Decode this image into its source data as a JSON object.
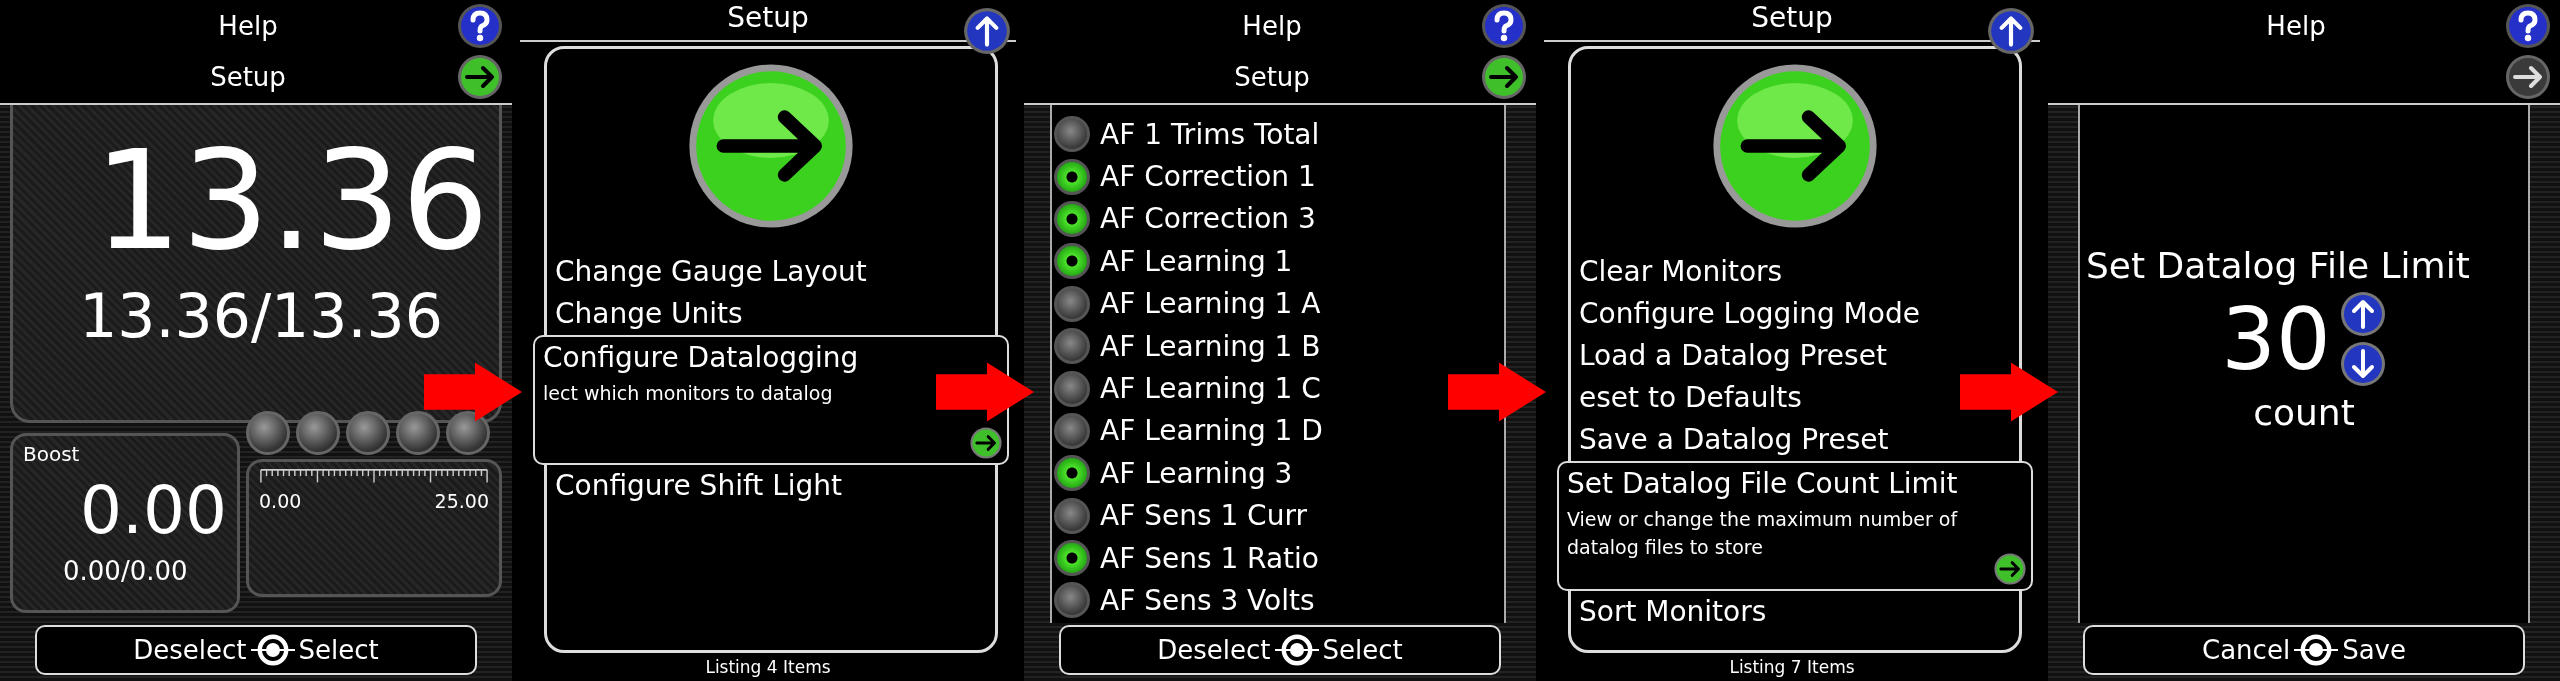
{
  "screens": [
    {
      "kind": "gauges",
      "header": {
        "help": "Help",
        "setup": "Setup",
        "next_enabled": true
      },
      "main_gauge": {
        "value": "13.36",
        "minmax": "13.36/13.36"
      },
      "indicators": [
        {
          "on": false
        },
        {
          "on": false
        },
        {
          "on": false
        },
        {
          "on": false
        },
        {
          "on": false
        }
      ],
      "boost": {
        "label": "Boost",
        "value": "0.00",
        "minmax": "0.00/0.00"
      },
      "bar_gauge": {
        "min": "0.00",
        "max": "25.00"
      },
      "footer": {
        "left": "Deselect",
        "right": "Select"
      }
    },
    {
      "kind": "menu",
      "title": "Setup",
      "items": [
        {
          "label": "Change Gauge Layout",
          "selected": false
        },
        {
          "label": "Change Units",
          "selected": false
        },
        {
          "label": "Configure Datalogging",
          "description": "lect which monitors to datalog",
          "selected": true
        },
        {
          "label": "Configure Shift Light",
          "selected": false
        }
      ],
      "status": "Listing 4 Items"
    },
    {
      "kind": "checklist",
      "header": {
        "help": "Help",
        "setup": "Setup",
        "next_enabled": true
      },
      "items": [
        {
          "label": "AF 1 Trims Total",
          "checked": false
        },
        {
          "label": "AF Correction 1",
          "checked": true
        },
        {
          "label": "AF Correction 3",
          "checked": true
        },
        {
          "label": "AF Learning 1",
          "checked": true
        },
        {
          "label": "AF Learning 1 A",
          "checked": false
        },
        {
          "label": "AF Learning 1 B",
          "checked": false
        },
        {
          "label": "AF Learning 1 C",
          "checked": false
        },
        {
          "label": "AF Learning 1 D",
          "checked": false
        },
        {
          "label": "AF Learning 3",
          "checked": true
        },
        {
          "label": "AF Sens 1 Curr",
          "checked": false
        },
        {
          "label": "AF Sens 1 Ratio",
          "checked": true
        },
        {
          "label": "AF Sens 3 Volts",
          "checked": false
        }
      ],
      "footer": {
        "left": "Deselect",
        "right": "Select"
      }
    },
    {
      "kind": "menu",
      "title": "Setup",
      "items": [
        {
          "label": "Clear Monitors",
          "selected": false
        },
        {
          "label": "Configure Logging Mode",
          "selected": false
        },
        {
          "label": "Load a Datalog Preset",
          "selected": false
        },
        {
          "label": "eset to Defaults",
          "selected": false
        },
        {
          "label": "Save a Datalog Preset",
          "selected": false
        },
        {
          "label": "Set Datalog File Count Limit",
          "description": "View or change the maximum number of datalog files to store",
          "selected": true
        },
        {
          "label": "Sort Monitors",
          "selected": false
        }
      ],
      "status": "Listing 7 Items"
    },
    {
      "kind": "editor",
      "header": {
        "help": "Help",
        "next_enabled": false
      },
      "title": "Set Datalog File Limit",
      "value": "30",
      "unit": "count",
      "footer": {
        "left": "Cancel",
        "right": "Save"
      }
    }
  ]
}
